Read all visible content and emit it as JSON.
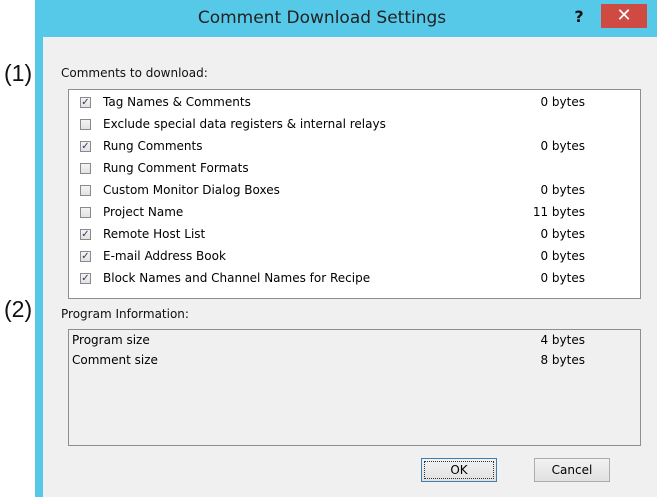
{
  "callouts": [
    "(1)",
    "(2)"
  ],
  "window": {
    "title": "Comment Download Settings",
    "help_label": "?",
    "close_label": "✕"
  },
  "comments_section": {
    "label": "Comments to download:",
    "items": [
      {
        "label": "Tag Names & Comments",
        "checked": true,
        "size": "0 bytes"
      },
      {
        "label": "Exclude special data registers & internal relays",
        "checked": false,
        "size": ""
      },
      {
        "label": "Rung Comments",
        "checked": true,
        "size": "0 bytes"
      },
      {
        "label": "Rung Comment Formats",
        "checked": false,
        "size": ""
      },
      {
        "label": "Custom Monitor Dialog Boxes",
        "checked": false,
        "size": "0 bytes"
      },
      {
        "label": "Project Name",
        "checked": false,
        "size": "11 bytes"
      },
      {
        "label": "Remote Host List",
        "checked": true,
        "size": "0 bytes"
      },
      {
        "label": "E-mail Address Book",
        "checked": true,
        "size": "0 bytes"
      },
      {
        "label": "Block Names and Channel Names for Recipe",
        "checked": true,
        "size": "0 bytes"
      }
    ]
  },
  "program_section": {
    "label": "Program Information:",
    "rows": [
      {
        "label": "Program size",
        "value": "4 bytes"
      },
      {
        "label": "Comment size",
        "value": "8 bytes"
      }
    ]
  },
  "buttons": {
    "ok_label": "OK",
    "cancel_label": "Cancel"
  },
  "colors": {
    "window_frame": "#56c9e9",
    "close_button": "#d04a44",
    "client_bg": "#f0f0f0"
  }
}
